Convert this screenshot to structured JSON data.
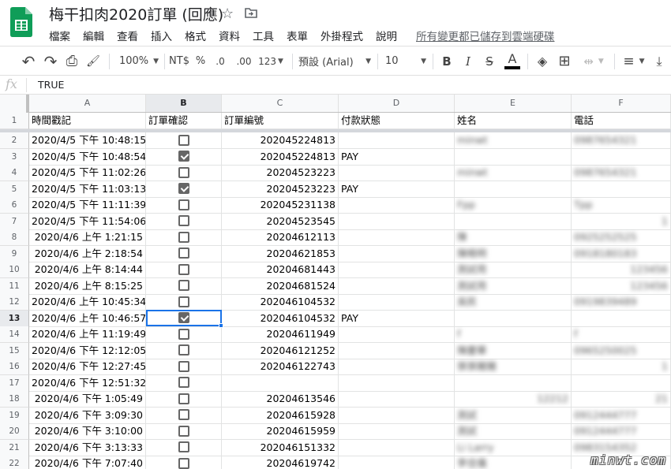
{
  "header": {
    "title": "梅干扣肉2020訂單 (回應)",
    "star_icon": "☆",
    "move_icon": "⬚",
    "menus": [
      "檔案",
      "編輯",
      "查看",
      "插入",
      "格式",
      "資料",
      "工具",
      "表單",
      "外掛程式",
      "說明"
    ],
    "save_status": "所有變更都已儲存到雲端硬碟"
  },
  "toolbar": {
    "undo_icon": "↶",
    "redo_icon": "↷",
    "print_icon": "⎙",
    "paint_format_icon": "🖌",
    "zoom": "100%",
    "currency": "NT$",
    "percent": "%",
    "decrease_decimal": ".0",
    "increase_decimal": ".00",
    "more_formats": "123",
    "font": "預設 (Arial)",
    "font_size": "10",
    "bold": "B",
    "italic": "I",
    "strike": "S",
    "text_color": "A",
    "fill_icon": "◈",
    "borders_icon": "⊞",
    "merge_icon": "⇹",
    "align_icon": "≡",
    "valign_icon": "⤓"
  },
  "formula": {
    "fx": "fx",
    "value": "TRUE"
  },
  "columns": [
    "A",
    "B",
    "C",
    "D",
    "E",
    "F"
  ],
  "header_row": {
    "num": "1",
    "cells": [
      "時間戳記",
      "訂單確認",
      "訂單編號",
      "付款狀態",
      "姓名",
      "電話"
    ]
  },
  "rows": [
    {
      "num": "2",
      "ts": "2020/4/5 下午 10:48:15",
      "checked": false,
      "order": "202045224813",
      "pay": "",
      "name": "minwt",
      "phone": "0987654321"
    },
    {
      "num": "3",
      "ts": "2020/4/5 下午 10:48:54",
      "checked": true,
      "order": "202045224813",
      "pay": "PAY",
      "name": "",
      "phone": ""
    },
    {
      "num": "4",
      "ts": "2020/4/5 下午 11:02:26",
      "checked": false,
      "order": "20204523223",
      "pay": "",
      "name": "minwt",
      "phone": "0987654321"
    },
    {
      "num": "5",
      "ts": "2020/4/5 下午 11:03:13",
      "checked": true,
      "order": "20204523223",
      "pay": "PAY",
      "name": "",
      "phone": ""
    },
    {
      "num": "6",
      "ts": "2020/4/5 下午 11:11:39",
      "checked": false,
      "order": "202045231138",
      "pay": "",
      "name": "Fpp",
      "phone": "Tpp"
    },
    {
      "num": "7",
      "ts": "2020/4/5 下午 11:54:06",
      "checked": false,
      "order": "20204523545",
      "pay": "",
      "name": "",
      "phone": "1"
    },
    {
      "num": "8",
      "ts": "2020/4/6 上午 1:21:15",
      "checked": false,
      "order": "20204612113",
      "pay": "",
      "name": "陳",
      "phone": "0925252525"
    },
    {
      "num": "9",
      "ts": "2020/4/6 上午 2:18:54",
      "checked": false,
      "order": "20204621853",
      "pay": "",
      "name": "陳曉明",
      "phone": "0918180183"
    },
    {
      "num": "10",
      "ts": "2020/4/6 上午 8:14:44",
      "checked": false,
      "order": "20204681443",
      "pay": "",
      "name": "測試用",
      "phone": "123456"
    },
    {
      "num": "11",
      "ts": "2020/4/6 上午 8:15:25",
      "checked": false,
      "order": "20204681524",
      "pay": "",
      "name": "測試用",
      "phone": "123456"
    },
    {
      "num": "12",
      "ts": "2020/4/6 上午 10:45:34",
      "checked": false,
      "order": "202046104532",
      "pay": "",
      "name": "吳民",
      "phone": "0919839489"
    },
    {
      "num": "13",
      "ts": "2020/4/6 上午 10:46:57",
      "checked": true,
      "order": "202046104532",
      "pay": "PAY",
      "name": "",
      "phone": ""
    },
    {
      "num": "14",
      "ts": "2020/4/6 上午 11:19:49",
      "checked": false,
      "order": "20204611949",
      "pay": "",
      "name": "f",
      "phone": "f"
    },
    {
      "num": "15",
      "ts": "2020/4/6 下午 12:12:05",
      "checked": false,
      "order": "202046121252",
      "pay": "",
      "name": "陳慶華",
      "phone": "0965250025"
    },
    {
      "num": "16",
      "ts": "2020/4/6 下午 12:27:45",
      "checked": false,
      "order": "202046122743",
      "pay": "",
      "name": "張張豬豬",
      "phone": "1"
    },
    {
      "num": "17",
      "ts": "2020/4/6 下午 12:51:32",
      "checked": false,
      "order": "",
      "pay": "",
      "name": "",
      "phone": ""
    },
    {
      "num": "18",
      "ts": "2020/4/6 下午 1:05:49",
      "checked": false,
      "order": "20204613546",
      "pay": "",
      "name": "12212",
      "phone": "21"
    },
    {
      "num": "19",
      "ts": "2020/4/6 下午 3:09:30",
      "checked": false,
      "order": "20204615928",
      "pay": "",
      "name": "測試",
      "phone": "0912444777"
    },
    {
      "num": "20",
      "ts": "2020/4/6 下午 3:10:00",
      "checked": false,
      "order": "20204615959",
      "pay": "",
      "name": "測試",
      "phone": "0912444777"
    },
    {
      "num": "21",
      "ts": "2020/4/6 下午 3:13:33",
      "checked": false,
      "order": "202046151332",
      "pay": "",
      "name": "Li Larry",
      "phone": "0983154352"
    },
    {
      "num": "22",
      "ts": "2020/4/6 下午 7:07:40",
      "checked": false,
      "order": "20204619742",
      "pay": "",
      "name": "李佳儀",
      "phone": ""
    }
  ],
  "watermark": "minwt.com",
  "colors": {
    "sheets_green": "#0f9d58",
    "selection_blue": "#1a73e8",
    "checkbox_gray": "#666666"
  }
}
